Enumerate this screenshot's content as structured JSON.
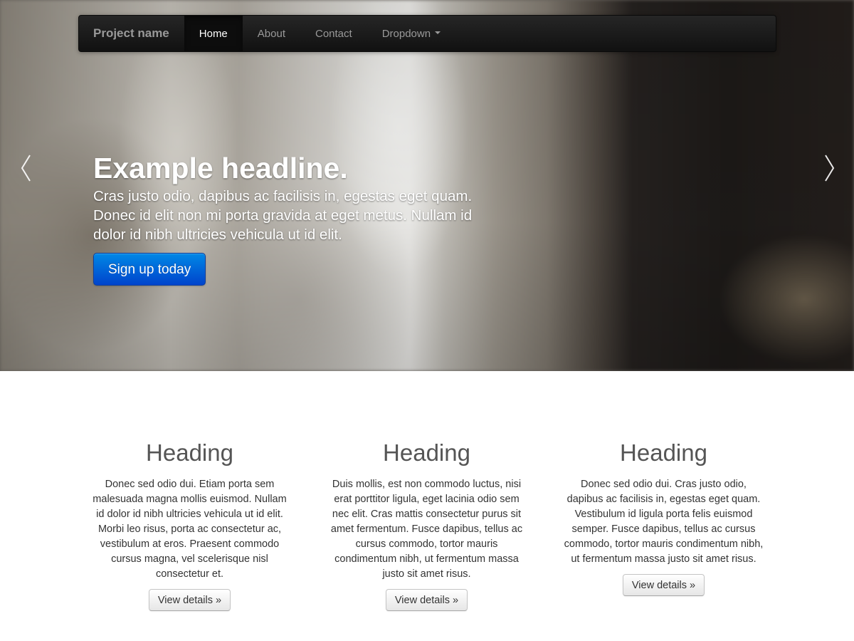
{
  "navbar": {
    "brand": "Project name",
    "items": [
      {
        "label": "Home",
        "active": true
      },
      {
        "label": "About",
        "active": false
      },
      {
        "label": "Contact",
        "active": false
      },
      {
        "label": "Dropdown",
        "active": false,
        "has_caret": true
      }
    ]
  },
  "carousel": {
    "headline": "Example headline.",
    "text_lines": [
      "Cras justo odio, dapibus ac facilisis in, egestas eget quam.",
      "Donec id elit non mi porta gravida at eget metus. Nullam id",
      "dolor id nibh ultricies vehicula ut id elit."
    ],
    "cta_label": "Sign up today",
    "prev_icon": "chevron-left-icon",
    "next_icon": "chevron-right-icon"
  },
  "columns": [
    {
      "heading": "Heading",
      "lines": [
        "Donec sed odio dui. Etiam porta sem",
        "malesuada magna mollis euismod. Nullam",
        "id dolor id nibh ultricies vehicula ut id elit.",
        "Morbi leo risus, porta ac consectetur ac,",
        "vestibulum at eros. Praesent commodo",
        "cursus magna, vel scelerisque nisl",
        "consectetur et."
      ],
      "button_label": "View details »"
    },
    {
      "heading": "Heading",
      "lines": [
        "Duis mollis, est non commodo luctus, nisi",
        "erat porttitor ligula, eget lacinia odio sem",
        "nec elit. Cras mattis consectetur purus sit",
        "amet fermentum. Fusce dapibus, tellus ac",
        "cursus commodo, tortor mauris",
        "condimentum nibh, ut fermentum massa",
        "justo sit amet risus."
      ],
      "button_label": "View details »"
    },
    {
      "heading": "Heading",
      "lines": [
        "Donec sed odio dui. Cras justo odio,",
        "dapibus ac facilisis in, egestas eget quam.",
        "Vestibulum id ligula porta felis euismod",
        "semper. Fusce dapibus, tellus ac cursus",
        "commodo, tortor mauris condimentum nibh,",
        "ut fermentum massa justo sit amet risus."
      ],
      "button_label": "View details »"
    }
  ],
  "colors": {
    "navbar_bg": "#1b1b1b",
    "nav_text": "#999999",
    "nav_active_text": "#ffffff",
    "primary_button": "#0066dd",
    "heading_text": "#555555",
    "body_text": "#333333"
  }
}
